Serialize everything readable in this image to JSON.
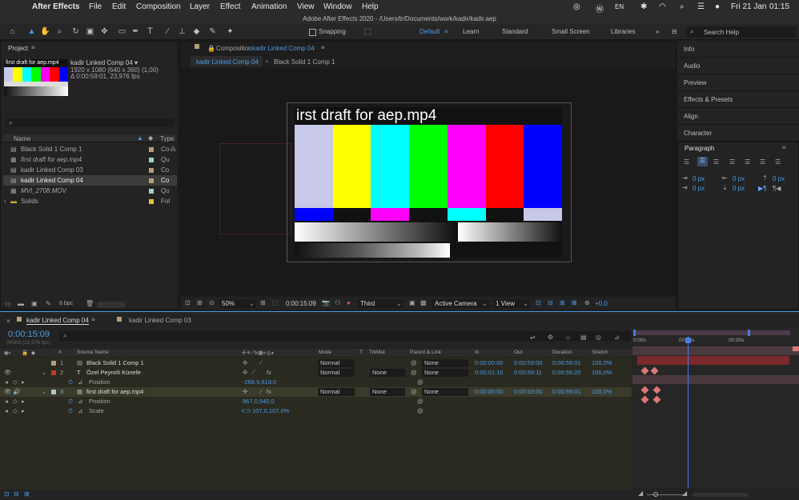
{
  "menubar": {
    "app": "After Effects",
    "items": [
      "File",
      "Edit",
      "Composition",
      "Layer",
      "Effect",
      "Animation",
      "View",
      "Window",
      "Help"
    ],
    "lang": "EN",
    "date": "Fri 21 Jan",
    "time": "01:15"
  },
  "titlebar": {
    "title": "Adobe After Effects 2020 - /Users/tr/Documents/work/kadir/kadir.aep"
  },
  "toolbar": {
    "snapping": "Snapping",
    "workspaces": [
      "Default",
      "Learn",
      "Standard",
      "Small Screen",
      "Libraries"
    ],
    "search_placeholder": "Search Help"
  },
  "project": {
    "title": "Project",
    "comp_name": "kadir Linked Comp 04 ▾",
    "comp_size": "1920 x 1080  (640 x 360) (1,00)",
    "comp_duration": "Δ 0:00:59:01, 23,976 fps",
    "thumb_label": "first draft for aep.mp4",
    "col_name": "Name",
    "col_type": "Type",
    "items": [
      {
        "name": "Black Solid 1 Comp 1",
        "type": "Co",
        "color": "#b5a07a"
      },
      {
        "name": "first draft for aep.mp4",
        "type": "Qu",
        "color": "#a9c9d4"
      },
      {
        "name": "kadir Linked Comp 03",
        "type": "Co",
        "color": "#b5a07a"
      },
      {
        "name": "kadir Linked Comp 04",
        "type": "Co",
        "color": "#b5a07a"
      },
      {
        "name": "MVI_2708.MOV",
        "type": "Qu",
        "color": "#a9c9d4"
      },
      {
        "name": "Solids",
        "type": "Fol",
        "color": "#e3c53a"
      }
    ],
    "bpc": "8 bpc"
  },
  "composition": {
    "tab_label": "Composition",
    "tab_comp": "kadir Linked Comp 04",
    "sub_tabs": [
      "kadir Linked Comp 04",
      "Black Solid 1 Comp 1"
    ],
    "overlay_text": "irst draft for aep.mp4",
    "footer": {
      "zoom": "50%",
      "timecode": "0:00:15:09",
      "resolution": "Third",
      "camera": "Active Camera",
      "views": "1 View",
      "exposure": "+0,0"
    }
  },
  "right_panels": [
    "Info",
    "Audio",
    "Preview",
    "Effects & Presets",
    "Align",
    "Character"
  ],
  "paragraph": {
    "title": "Paragraph",
    "values": [
      "0 px",
      "0 px",
      "0 px",
      "0 px",
      "0 px"
    ]
  },
  "timeline": {
    "tabs": [
      "kadir Linked Comp 04",
      "kadir Linked Comp 03"
    ],
    "timecode": "0:00:15:09",
    "frames": "00369 (23,976 fps)",
    "columns": {
      "source": "Source Name",
      "mode": "Mode",
      "t": "T",
      "trkmat": "TrkMat",
      "parent": "Parent & Link",
      "in": "In",
      "out": "Out",
      "duration": "Duration",
      "stretch": "Stretch"
    },
    "ruler": [
      "0:00s",
      "00:15s",
      "00:30s"
    ],
    "layers": [
      {
        "num": "1",
        "name": "Black Solid 1 Comp 1",
        "color": "#b5a07a",
        "mode": "Normal",
        "trkmat": "",
        "parent": "None",
        "in": "0:00:00:00",
        "out": "0:00:59:00",
        "duration": "0:00:59:01",
        "stretch": "100,0%"
      },
      {
        "num": "2",
        "name": "Özel       Peynirli       Künefe",
        "color": "#c0392b",
        "mode": "Normal",
        "trkmat": "None",
        "parent": "None",
        "in": "0:00:01:16",
        "out": "0:00:58:11",
        "duration": "0:00:56:20",
        "stretch": "100,0%"
      },
      {
        "num": "3",
        "name": "first draft for aep.mp4",
        "color": "#a9c9d4",
        "mode": "Normal",
        "trkmat": "None",
        "parent": "None",
        "in": "0:00:00:00",
        "out": "0:00:59:00",
        "duration": "0:00:59:01",
        "stretch": "100,0%"
      }
    ],
    "props": [
      {
        "name": "Position",
        "value": "-268,9,619,0"
      },
      {
        "name": "Position",
        "value": "967,0,540,0"
      },
      {
        "name": "Scale",
        "value": "107,0,107,0%"
      }
    ]
  },
  "colors": {
    "accent": "#4a9be6",
    "bar_colors": [
      "#c8c8e8",
      "#ffff00",
      "#00ffff",
      "#00ff00",
      "#ff00ff",
      "#ff0000",
      "#0000ff"
    ]
  }
}
